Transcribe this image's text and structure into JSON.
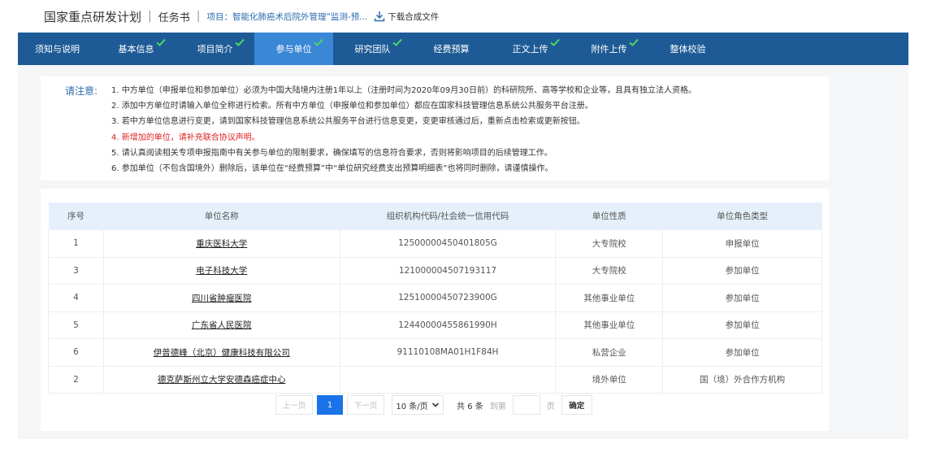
{
  "header": {
    "brand": "国家重点研发计划",
    "doc_type": "任务书",
    "project": "项目：智能化肺癌术后院外管理“监测-预...",
    "download_label": "下载合成文件"
  },
  "tabs": [
    {
      "label": "须知与说明",
      "checked": false,
      "active": false
    },
    {
      "label": "基本信息",
      "checked": true,
      "active": false
    },
    {
      "label": "项目简介",
      "checked": true,
      "active": false
    },
    {
      "label": "参与单位",
      "checked": true,
      "active": true
    },
    {
      "label": "研究团队",
      "checked": true,
      "active": false
    },
    {
      "label": "经费预算",
      "checked": false,
      "active": false
    },
    {
      "label": "正文上传",
      "checked": true,
      "active": false
    },
    {
      "label": "附件上传",
      "checked": true,
      "active": false
    },
    {
      "label": "整体校验",
      "checked": false,
      "active": false
    }
  ],
  "notice": {
    "label": "请注意:",
    "items": [
      {
        "text": "1. 中方单位（申报单位和参加单位）必须为中国大陆境内注册1年以上（注册时间为2020年09月30日前）的科研院所、高等学校和企业等，且具有独立法人资格。",
        "red": false
      },
      {
        "text": "2. 添加中方单位时请输入单位全称进行检索。所有中方单位（申报单位和参加单位）都应在国家科技管理信息系统公共服务平台注册。",
        "red": false
      },
      {
        "text": "3. 若中方单位信息进行变更，请到国家科技管理信息系统公共服务平台进行信息变更，变更审核通过后，重新点击检索或更新按钮。",
        "red": false
      },
      {
        "text": "4. 新增加的单位，请补充联合协议声明。",
        "red": true
      },
      {
        "text": "5. 请认真阅读相关专项申报指南中有关参与单位的限制要求，确保填写的信息符合要求，否则将影响项目的后续管理工作。",
        "red": false
      },
      {
        "text": "6. 参加单位（不包含国境外）删除后，该单位在“经费预算”中“单位研究经费支出预算明细表”也将同时删除，请谨慎操作。",
        "red": false
      }
    ]
  },
  "table": {
    "columns": [
      "序号",
      "单位名称",
      "组织机构代码/社会统一信用代码",
      "单位性质",
      "单位角色类型"
    ],
    "rows": [
      {
        "no": "1",
        "name": "重庆医科大学",
        "code": "12500000450401805G",
        "nature": "大专院校",
        "role": "申报单位"
      },
      {
        "no": "3",
        "name": "电子科技大学",
        "code": "121000004507193117",
        "nature": "大专院校",
        "role": "参加单位"
      },
      {
        "no": "4",
        "name": "四川省肿瘤医院",
        "code": "12510000450723900G",
        "nature": "其他事业单位",
        "role": "参加单位"
      },
      {
        "no": "5",
        "name": "广东省人民医院",
        "code": "12440000455861990H",
        "nature": "其他事业单位",
        "role": "参加单位"
      },
      {
        "no": "6",
        "name": "伊普德峰（北京）健康科技有限公司",
        "code": "91110108MA01H1F84H",
        "nature": "私营企业",
        "role": "参加单位"
      },
      {
        "no": "2",
        "name": "德克萨斯州立大学安德森癌症中心",
        "code": "",
        "nature": "境外单位",
        "role": "国（境）外合作方机构"
      }
    ]
  },
  "pager": {
    "prev": "上一页",
    "current": "1",
    "next": "下一页",
    "page_size": "10 条/页",
    "total": "共 6 条",
    "goto": "到第",
    "page_unit": "页",
    "confirm": "确定"
  },
  "colors": {
    "tab_bar": "#1e5b96",
    "tab_active": "#3a87d6",
    "check": "#4cd964",
    "link_blue": "#2b6cb0",
    "warning_red": "#e02020",
    "table_header": "#e6f0fb",
    "pager_active": "#1a73e8"
  }
}
